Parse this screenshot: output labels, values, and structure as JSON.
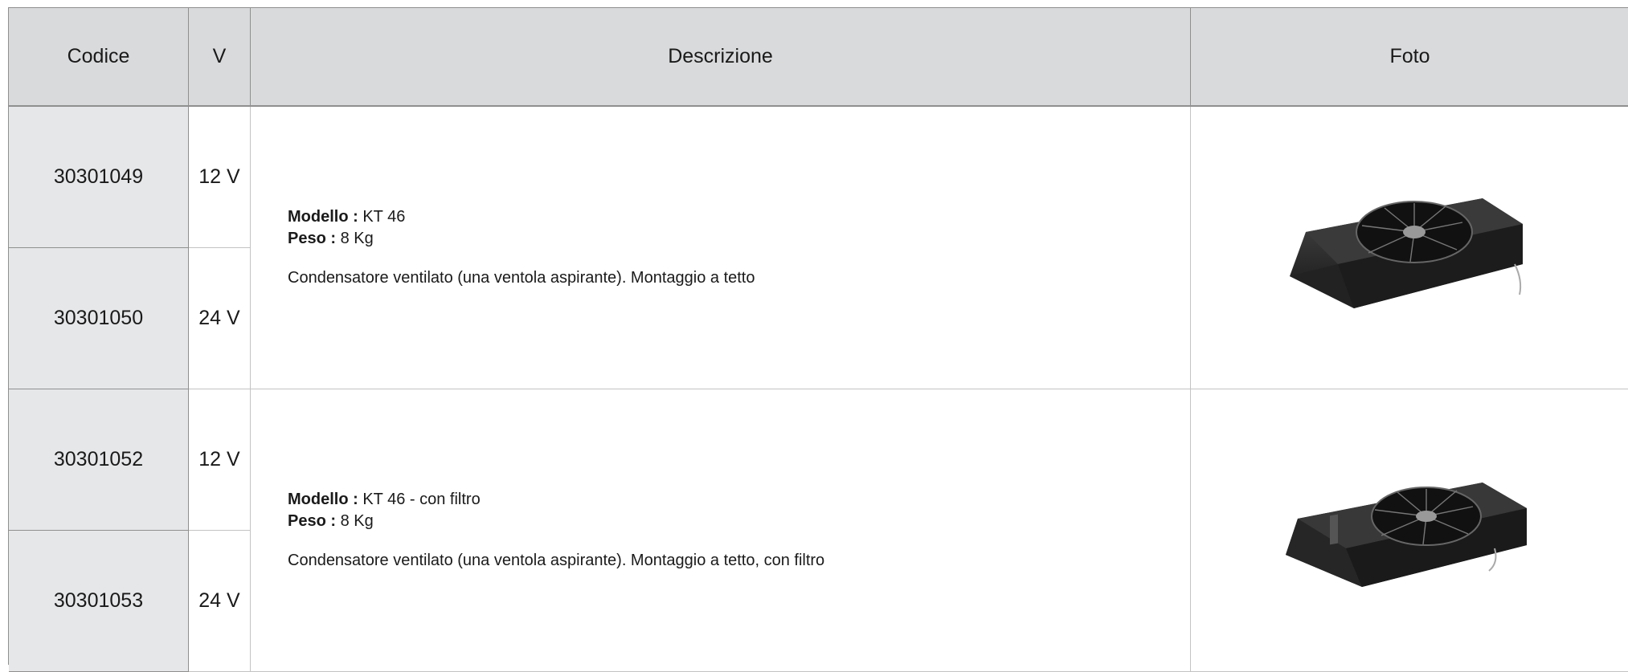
{
  "headers": {
    "code": "Codice",
    "voltage": "V",
    "description": "Descrizione",
    "photo": "Foto"
  },
  "products": [
    {
      "variants": [
        {
          "code": "30301049",
          "voltage": "12 V"
        },
        {
          "code": "30301050",
          "voltage": "24 V"
        }
      ],
      "model_label": "Modello :",
      "model": "KT 46",
      "weight_label": "Peso :",
      "weight": "8 Kg",
      "description": "Condensatore ventilato (una ventola aspirante). Montaggio a tetto",
      "photo_icon": "roof-condenser-fan-image"
    },
    {
      "variants": [
        {
          "code": "30301052",
          "voltage": "12 V"
        },
        {
          "code": "30301053",
          "voltage": "24 V"
        }
      ],
      "model_label": "Modello :",
      "model": "KT 46 - con filtro",
      "weight_label": "Peso :",
      "weight": "8 Kg",
      "description": "Condensatore ventilato (una ventola aspirante). Montaggio a tetto, con filtro",
      "photo_icon": "roof-condenser-fan-with-filter-image"
    }
  ]
}
